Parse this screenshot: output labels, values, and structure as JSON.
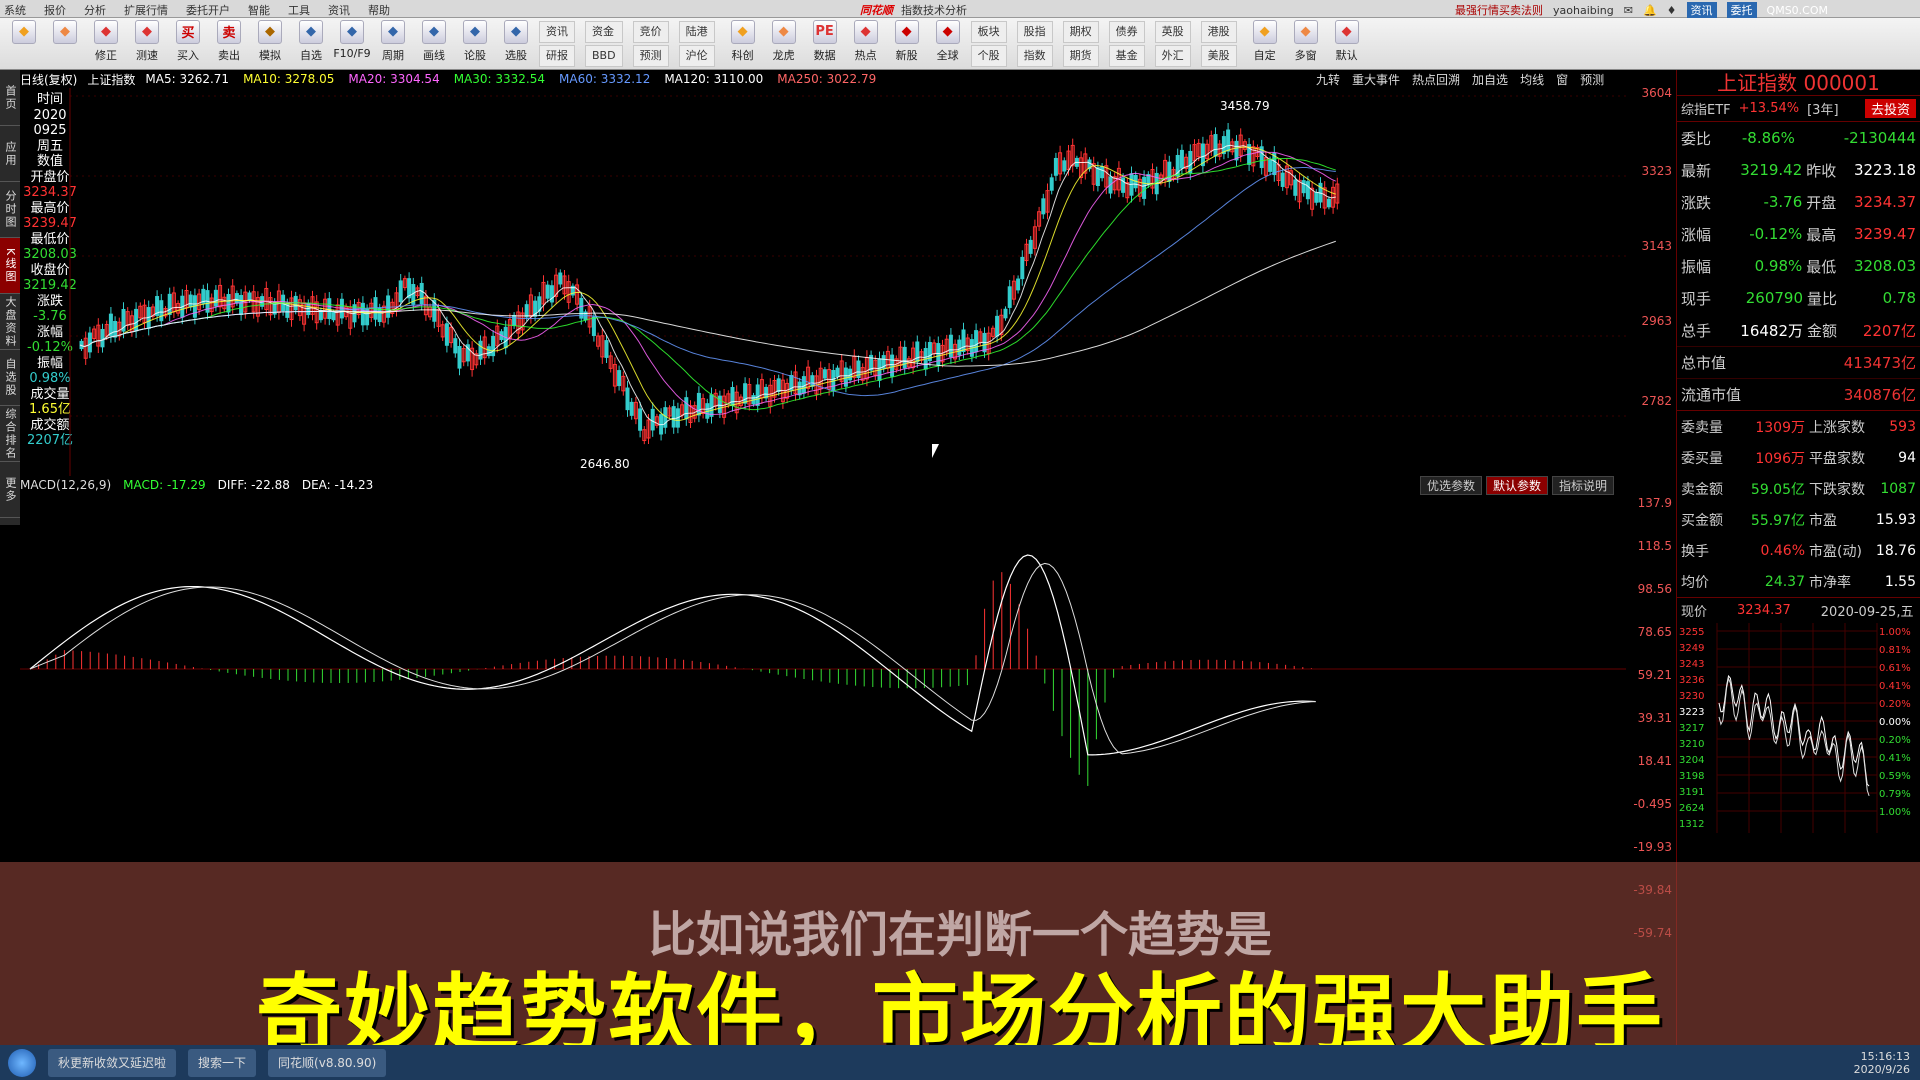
{
  "titlebar": {
    "menu": [
      "系统",
      "报价",
      "分析",
      "扩展行情",
      "委托开户",
      "智能",
      "工具",
      "资讯",
      "帮助"
    ],
    "logo": "同花顺",
    "title": "指数技术分析",
    "right_link": "最强行情买卖法则",
    "user": "yaohaibing",
    "tags": [
      "资讯",
      "委托"
    ],
    "watermark": "QMS0.COM"
  },
  "toolbar": {
    "buttons": [
      {
        "label": "",
        "icon": "grid-icon"
      },
      {
        "label": "",
        "icon": "back-arrow-icon"
      },
      {
        "label": "修正",
        "icon": "up-down-icon"
      },
      {
        "label": "测速",
        "icon": "clock-icon"
      },
      {
        "label": "买入",
        "icon": "buy-icon",
        "glyph": "买"
      },
      {
        "label": "卖出",
        "icon": "sell-icon",
        "glyph": "卖"
      },
      {
        "label": "模拟",
        "icon": "hammer-icon"
      },
      {
        "label": "自选",
        "icon": "monitor-icon"
      },
      {
        "label": "F10/F9",
        "icon": "f10-icon"
      },
      {
        "label": "周期",
        "icon": "cycle-icon"
      },
      {
        "label": "画线",
        "icon": "pen-icon"
      },
      {
        "label": "论股",
        "icon": "discuss-icon"
      },
      {
        "label": "选股",
        "icon": "search-icon"
      }
    ],
    "pairs": [
      [
        "资讯",
        "研报"
      ],
      [
        "资金",
        "BBD"
      ],
      [
        "竞价",
        "预测"
      ],
      [
        "陆港",
        "沪伦"
      ]
    ],
    "buttons2": [
      {
        "label": "科创",
        "icon": "chip-icon"
      },
      {
        "label": "龙虎",
        "icon": "dragon-icon"
      },
      {
        "label": "数据",
        "icon": "pe-icon",
        "glyph": "PE"
      },
      {
        "label": "热点",
        "icon": "flame-icon"
      },
      {
        "label": "新股",
        "icon": "new-icon"
      },
      {
        "label": "全球",
        "icon": "globe-icon"
      }
    ],
    "pairs2": [
      [
        "板块",
        "个股"
      ],
      [
        "股指",
        "指数"
      ],
      [
        "期权",
        "期货"
      ],
      [
        "债券",
        "基金"
      ],
      [
        "英股",
        "外汇"
      ],
      [
        "港股",
        "美股"
      ]
    ],
    "buttons3": [
      {
        "label": "自定",
        "icon": "custom-icon"
      },
      {
        "label": "多窗",
        "icon": "windows-icon"
      },
      {
        "label": "默认",
        "icon": "home-icon"
      }
    ]
  },
  "side_tabs": [
    "首页",
    "应用",
    "分时图",
    "K线图",
    "大盘资料",
    "自选股",
    "综合排名",
    "更多"
  ],
  "infobar": {
    "period": "日线(复权)",
    "name": "上证指数",
    "ma": [
      {
        "label": "MA5: 3262.71",
        "color": "#ffffff"
      },
      {
        "label": "MA10: 3278.05",
        "color": "#ffff33"
      },
      {
        "label": "MA20: 3304.54",
        "color": "#ff66ff"
      },
      {
        "label": "MA30: 3332.54",
        "color": "#33ff33"
      },
      {
        "label": "MA60: 3332.12",
        "color": "#6699ff"
      },
      {
        "label": "MA120: 3110.00",
        "color": "#ffffff"
      },
      {
        "label": "MA250: 3022.79",
        "color": "#ff6666"
      }
    ],
    "right_tools": [
      "九转",
      "重大事件",
      "热点回溯",
      "加自选",
      "均线",
      "窗",
      "预测"
    ]
  },
  "left_values": {
    "items": [
      {
        "t": "时间",
        "c": "white"
      },
      {
        "t": "2020",
        "c": "white"
      },
      {
        "t": "0925",
        "c": "white"
      },
      {
        "t": "周五",
        "c": "white"
      },
      {
        "t": "数值",
        "c": "white"
      },
      {
        "t": "开盘价",
        "c": "white"
      },
      {
        "t": "3234.37",
        "c": "red"
      },
      {
        "t": "最高价",
        "c": "white"
      },
      {
        "t": "3239.47",
        "c": "red"
      },
      {
        "t": "最低价",
        "c": "white"
      },
      {
        "t": "3208.03",
        "c": "green"
      },
      {
        "t": "收盘价",
        "c": "white"
      },
      {
        "t": "3219.42",
        "c": "green"
      },
      {
        "t": "涨跌",
        "c": "white"
      },
      {
        "t": "-3.76",
        "c": "green"
      },
      {
        "t": "涨幅",
        "c": "white"
      },
      {
        "t": "-0.12%",
        "c": "green"
      },
      {
        "t": "振幅",
        "c": "white"
      },
      {
        "t": "0.98%",
        "c": "cyan"
      },
      {
        "t": "成交量",
        "c": "white"
      },
      {
        "t": "1.65亿",
        "c": "yellow"
      },
      {
        "t": "成交额",
        "c": "white"
      },
      {
        "t": "2207亿",
        "c": "cyan"
      }
    ]
  },
  "kline": {
    "high_label": "3458.79",
    "low_label": "2646.80"
  },
  "price_axis": [
    "3604",
    "3323",
    "3143",
    "2963",
    "2782"
  ],
  "macd": {
    "title": "MACD(12,26,9)",
    "macd": "MACD: -17.29",
    "diff": "DIFF: -22.88",
    "dea": "DEA: -14.23",
    "params": [
      "优选参数",
      "默认参数",
      "指标说明"
    ],
    "axis": [
      "137.9",
      "118.5",
      "98.56",
      "78.65",
      "59.21",
      "39.31",
      "18.41",
      "-0.495",
      "-19.93",
      "-39.84",
      "-59.74"
    ]
  },
  "quote": {
    "title": "上证指数 000001",
    "etf_label": "综指ETF",
    "etf_change": "+13.54%",
    "etf_period": "[3年]",
    "etf_button": "去投资",
    "rows": [
      {
        "l": "委比",
        "v": "-8.86%",
        "vc": "green",
        "l2": "",
        "v2": "-2130444",
        "v2c": "green"
      },
      {
        "l": "最新",
        "v": "3219.42",
        "vc": "green",
        "l2": "昨收",
        "v2": "3223.18",
        "v2c": "white"
      },
      {
        "l": "涨跌",
        "v": "-3.76",
        "vc": "green",
        "l2": "开盘",
        "v2": "3234.37",
        "v2c": "red"
      },
      {
        "l": "涨幅",
        "v": "-0.12%",
        "vc": "green",
        "l2": "最高",
        "v2": "3239.47",
        "v2c": "red"
      },
      {
        "l": "振幅",
        "v": "0.98%",
        "vc": "green",
        "l2": "最低",
        "v2": "3208.03",
        "v2c": "green"
      },
      {
        "l": "现手",
        "v": "260790",
        "vc": "green",
        "l2": "量比",
        "v2": "0.78",
        "v2c": "green"
      },
      {
        "l": "总手",
        "v": "16482万",
        "vc": "white",
        "l2": "金额",
        "v2": "2207亿",
        "v2c": "red"
      }
    ],
    "wide": [
      {
        "l": "总市值",
        "v": "413473亿"
      },
      {
        "l": "流通市值",
        "v": "340876亿"
      }
    ],
    "stats": [
      {
        "l": "委卖量",
        "v": "1309万",
        "vc": "red",
        "l2": "上涨家数",
        "v2": "593",
        "v2c": "red"
      },
      {
        "l": "委买量",
        "v": "1096万",
        "vc": "red",
        "l2": "平盘家数",
        "v2": "94",
        "v2c": "white"
      },
      {
        "l": "卖金额",
        "v": "59.05亿",
        "vc": "green",
        "l2": "下跌家数",
        "v2": "1087",
        "v2c": "green"
      },
      {
        "l": "买金额",
        "v": "55.97亿",
        "vc": "green",
        "l2": "市盈",
        "v2": "15.93",
        "v2c": "white"
      },
      {
        "l": "换手",
        "v": "0.46%",
        "vc": "red",
        "l2": "市盈(动)",
        "v2": "18.76",
        "v2c": "white"
      },
      {
        "l": "均价",
        "v": "24.37",
        "vc": "green",
        "l2": "市净率",
        "v2": "1.55",
        "v2c": "white"
      }
    ],
    "mini_label": "现价",
    "mini_price": "3234.37",
    "mini_date": "2020-09-25,五",
    "mini_axis_left": [
      "3255",
      "3249",
      "3243",
      "3236",
      "3230",
      "3223",
      "3217",
      "3210",
      "3204",
      "3198",
      "3191",
      "2624",
      "1312"
    ],
    "mini_axis_right": [
      "1.00%",
      "0.81%",
      "0.61%",
      "0.41%",
      "0.20%",
      "0.00%",
      "0.20%",
      "0.41%",
      "0.59%",
      "0.79%",
      "1.00%"
    ]
  },
  "captions": {
    "sub": "比如说我们在判断一个趋势是",
    "main": "奇妙趋势软件，市场分析的强大助手"
  },
  "taskbar": {
    "tasks": [
      "秋更新收敛又延迟啦",
      "搜索一下",
      "同花顺(v8.80.90)"
    ],
    "time": "15:16:13",
    "date": "2020/9/26"
  }
}
